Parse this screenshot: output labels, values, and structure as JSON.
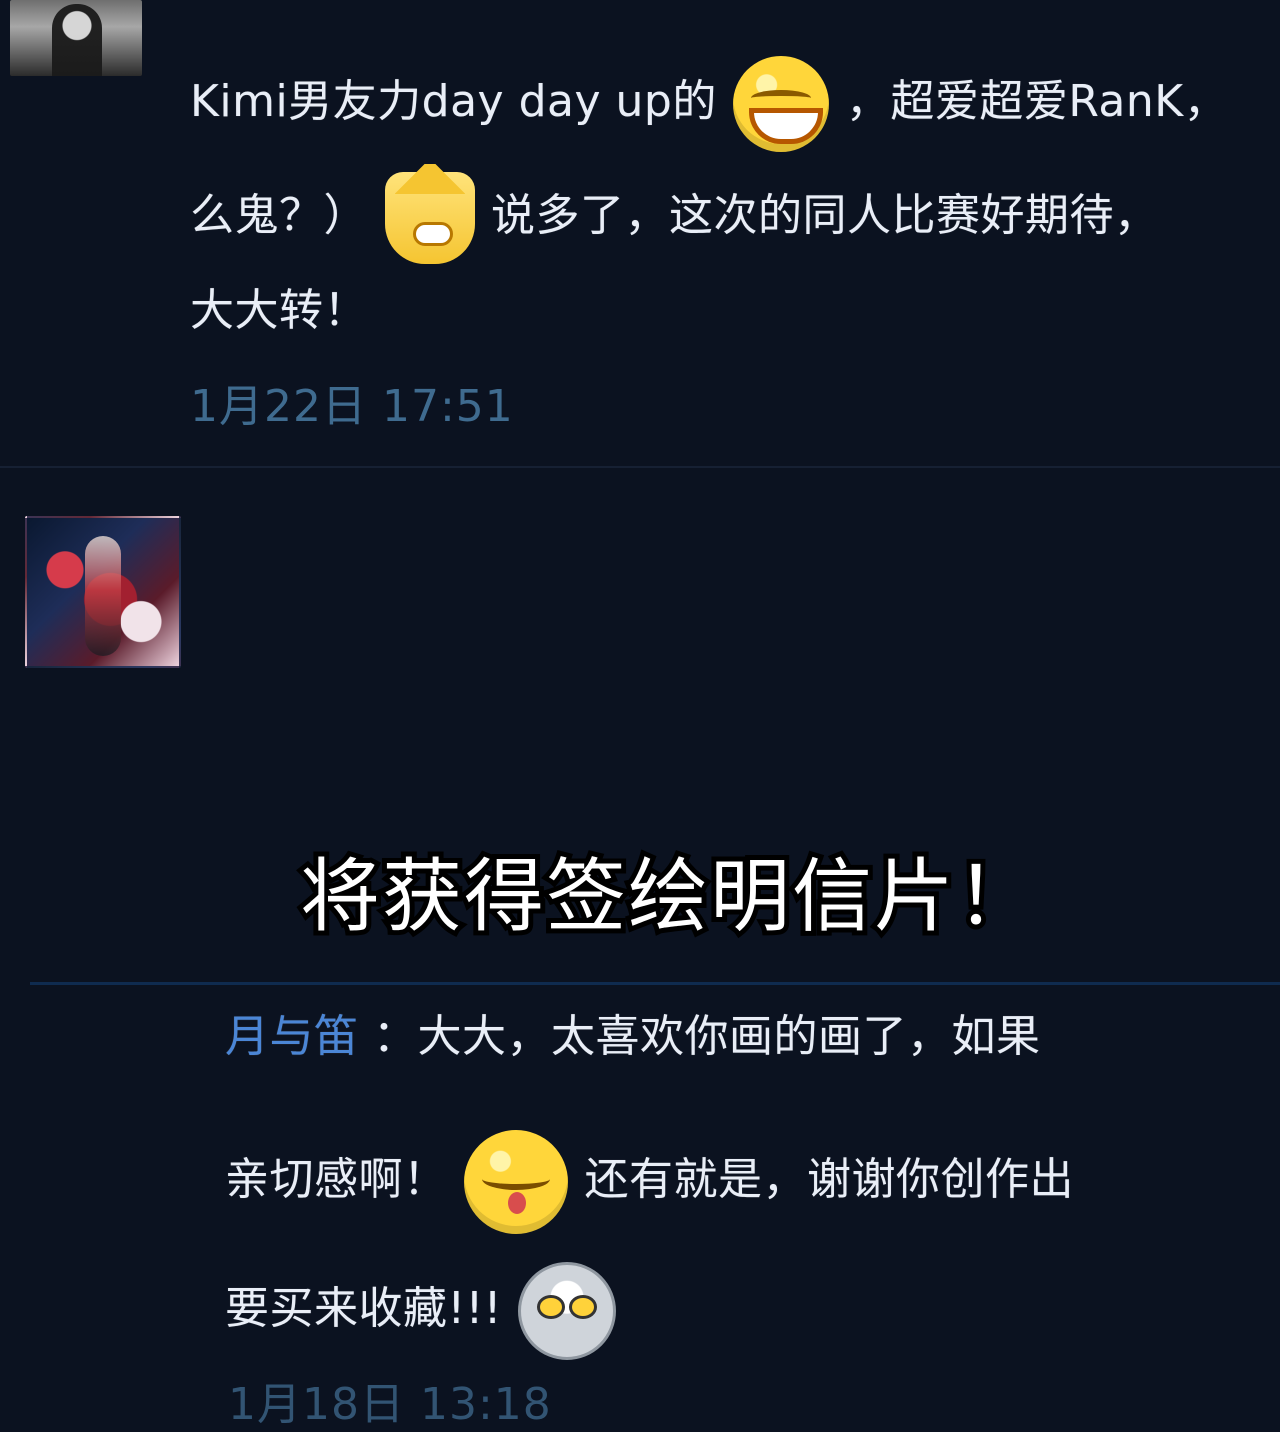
{
  "comments": [
    {
      "lines": [
        [
          {
            "type": "text",
            "value": "Kimi男友力day day up的"
          },
          {
            "type": "emoji",
            "value": "grin-emoji"
          },
          {
            "type": "text",
            "value": "，超爱超爱RanK，"
          }
        ],
        [
          {
            "type": "text",
            "value": "么鬼？）"
          },
          {
            "type": "emoji",
            "value": "doge-emoji"
          },
          {
            "type": "text",
            "value": "说多了，这次的同人比赛好期待，"
          }
        ],
        [
          {
            "type": "text",
            "value": "大大转！"
          }
        ]
      ],
      "timestamp": "1月22日 17:51"
    },
    {
      "username": "月与笛",
      "lines": [
        [
          {
            "type": "text",
            "value": "：大大，太喜欢你画的画了，如果"
          }
        ],
        [
          {
            "type": "text",
            "value": "亲切感啊！"
          },
          {
            "type": "emoji",
            "value": "sleepy-emoji"
          },
          {
            "type": "text",
            "value": "还有就是，谢谢你创作出"
          }
        ],
        [
          {
            "type": "text",
            "value": "要买来收藏!!!"
          },
          {
            "type": "emoji",
            "value": "ultraman-emoji"
          }
        ]
      ],
      "timestamp": "1月18日 13:18"
    }
  ],
  "overlay": {
    "caption": "将获得签绘明信片！"
  },
  "colors": {
    "background": "#0b1220",
    "text": "#e9eef7",
    "username": "#4b86d6",
    "timestamp": "#3f6b8f"
  }
}
